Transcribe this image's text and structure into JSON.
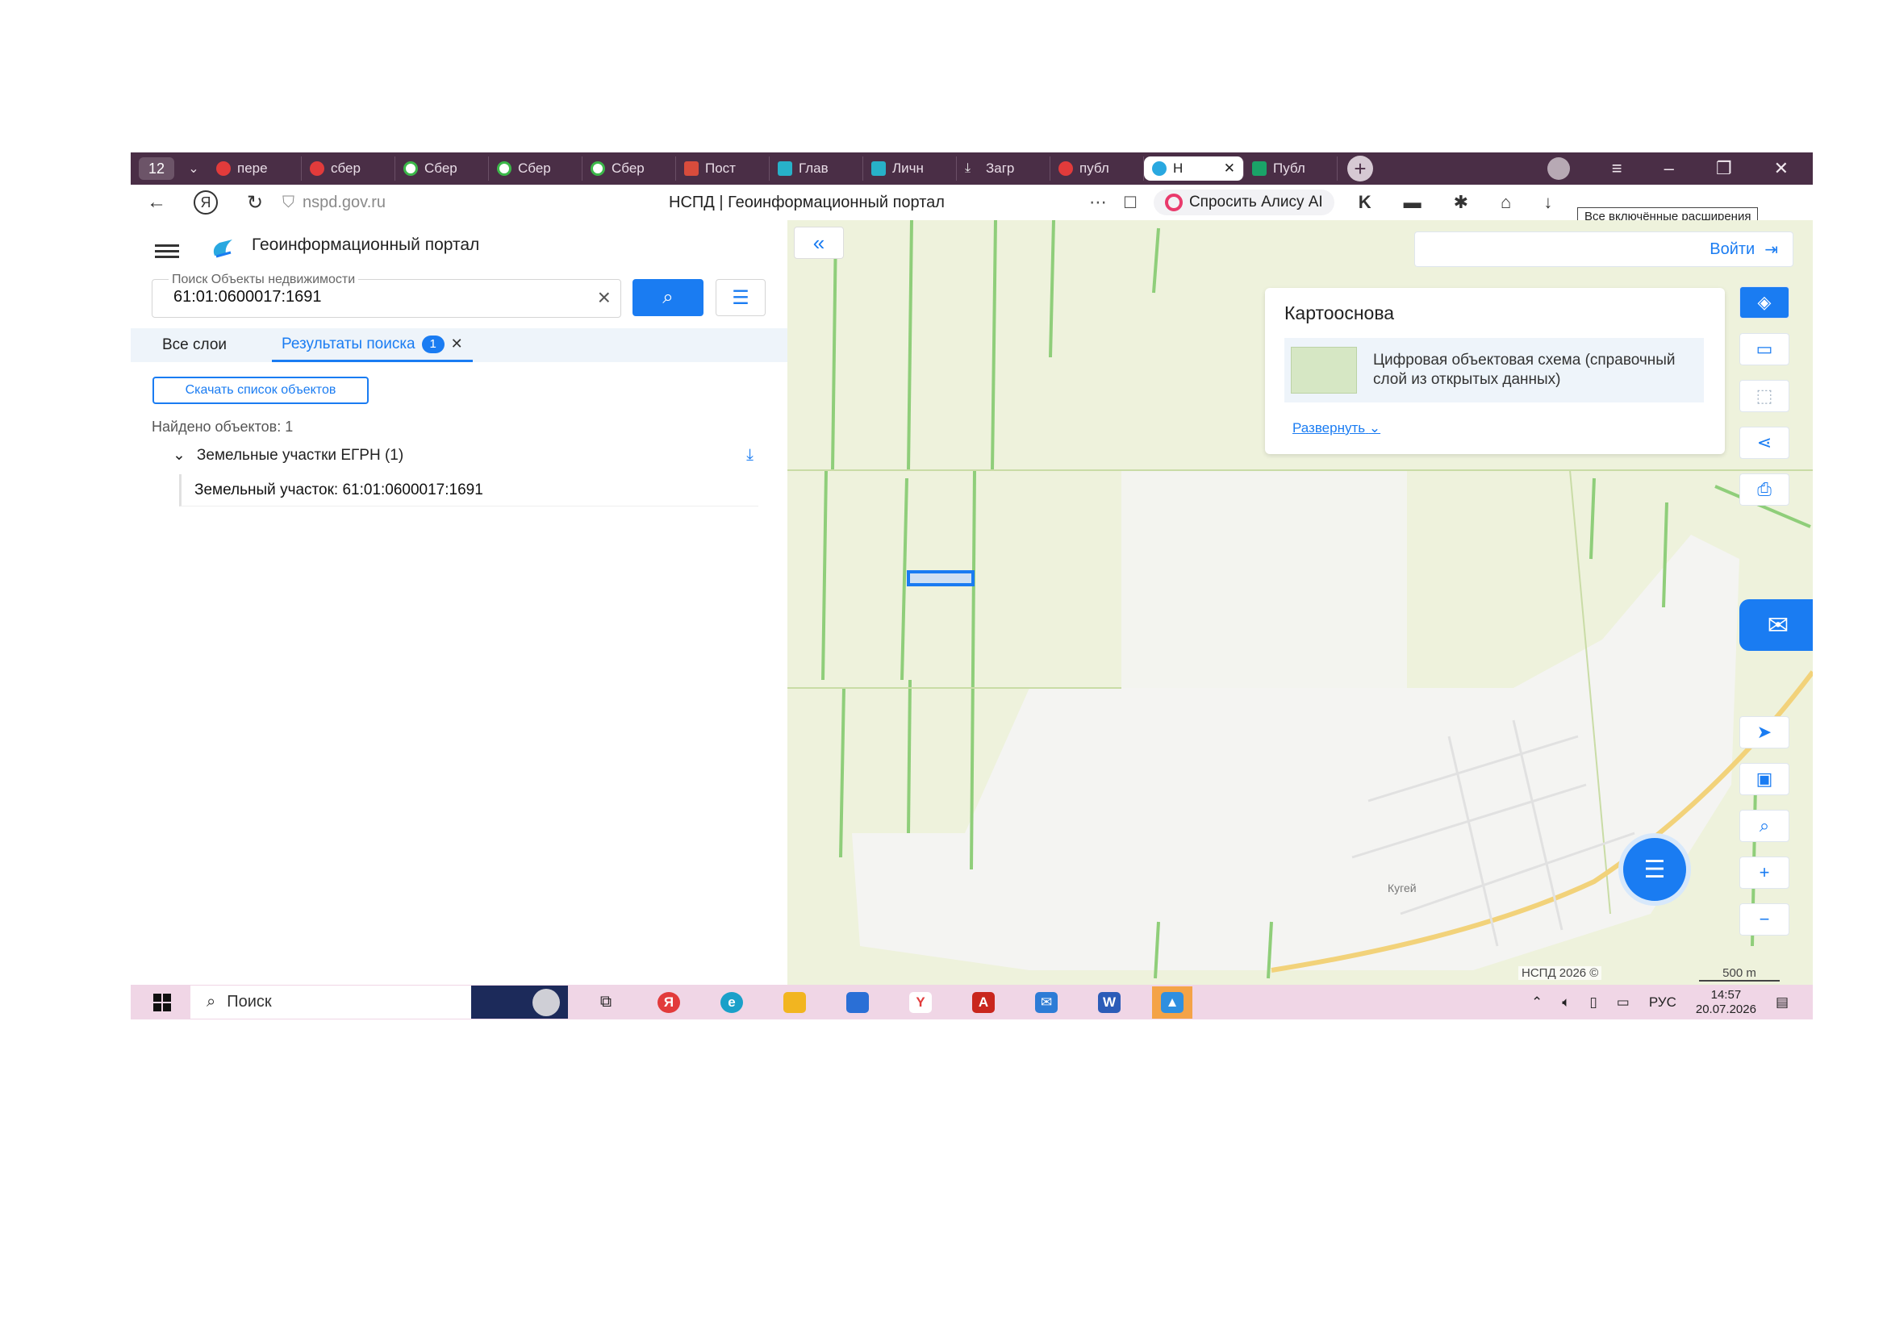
{
  "browser": {
    "tab_count": "12",
    "tabs": [
      {
        "label": "пере",
        "icon": "yandex-icon",
        "kind": "y"
      },
      {
        "label": "сбер",
        "icon": "yandex-icon",
        "kind": "y"
      },
      {
        "label": "Сбер",
        "icon": "sber-icon",
        "kind": "g"
      },
      {
        "label": "Сбер",
        "icon": "sber-icon",
        "kind": "g"
      },
      {
        "label": "Сбер",
        "icon": "sber-icon",
        "kind": "g"
      },
      {
        "label": "Пост",
        "icon": "document-icon",
        "kind": "d"
      },
      {
        "label": "Глав",
        "icon": "gosuslugi-icon",
        "kind": "s"
      },
      {
        "label": "Личн",
        "icon": "gosuslugi-icon",
        "kind": "s"
      },
      {
        "label": "Загр",
        "icon": "download-icon",
        "kind": "dl"
      },
      {
        "label": "публ",
        "icon": "yandex-icon",
        "kind": "y"
      },
      {
        "label": "Н",
        "icon": "nspd-icon",
        "kind": "n",
        "active": true
      },
      {
        "label": "Публ",
        "icon": "rosreestr-icon",
        "kind": "p"
      }
    ],
    "url": "nspd.gov.ru",
    "page_title": "НСПД | Геоинформационный портал",
    "alice_label": "Спросить Алису AI",
    "extensions_tooltip": "Все включённые расширения"
  },
  "portal": {
    "brand": "Геоинформационный портал",
    "search": {
      "label": "Поиск Объекты недвижимости",
      "value": "61:01:0600017:1691"
    },
    "tabs": {
      "all_layers": "Все слои",
      "results": "Результаты поиска",
      "results_count": "1"
    },
    "download_list": "Скачать список объектов",
    "found": "Найдено объектов: 1",
    "group_title": "Земельные участки ЕГРН (1)",
    "result_item": "Земельный участок: 61:01:0600017:1691"
  },
  "map": {
    "login": "Войти",
    "basemap_title": "Картооснова",
    "basemap_layer": "Цифровая объектовая схема (справочный слой из открытых данных)",
    "expand": "Развернуть",
    "place_label": "Кугей",
    "copyright": "НСПД 2026 ©",
    "scale": "500 m"
  },
  "taskbar": {
    "search_placeholder": "Поиск",
    "lang": "РУС",
    "time": "14:57",
    "date": "20.07.2026"
  },
  "colors": {
    "accent": "#1a7cf2",
    "tabstrip": "#4a2e46",
    "taskbar": "#f0d6e6",
    "map_background": "#eef2dc"
  }
}
